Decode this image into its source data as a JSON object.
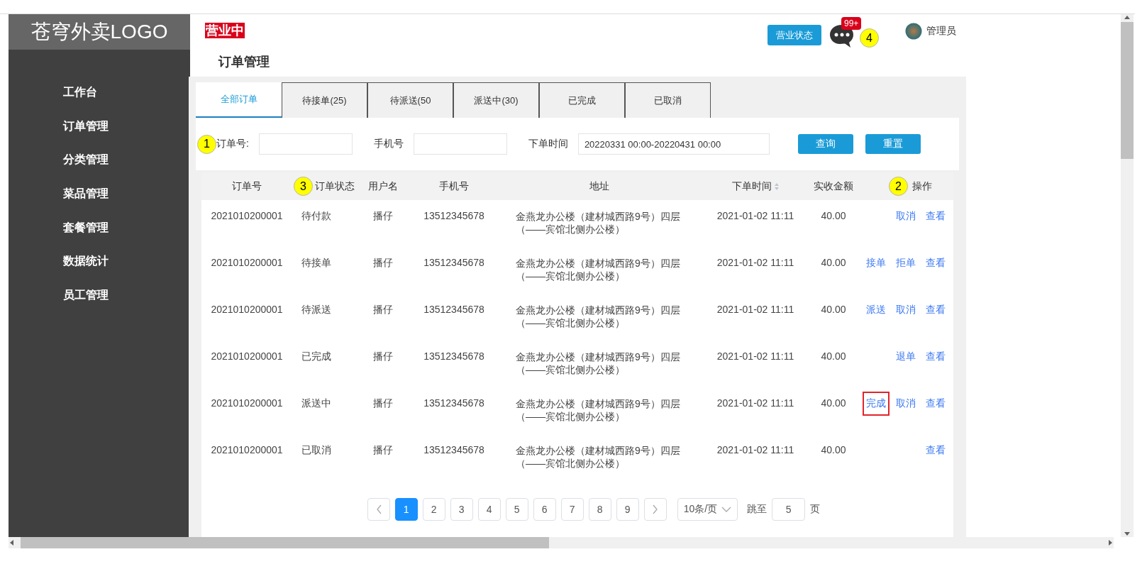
{
  "sidebar": {
    "logo": "苍穹外卖LOGO",
    "items": [
      {
        "label": "工作台"
      },
      {
        "label": "订单管理"
      },
      {
        "label": "分类管理"
      },
      {
        "label": "菜品管理"
      },
      {
        "label": "套餐管理"
      },
      {
        "label": "数据统计"
      },
      {
        "label": "员工管理"
      }
    ]
  },
  "header": {
    "status_badge": "营业中",
    "page_title": "订单管理",
    "status_button": "营业状态",
    "message_count": "99+",
    "message_marker": "4",
    "user": "管理员"
  },
  "tabs": [
    {
      "label": "全部订单",
      "selected": true
    },
    {
      "label": "待接单(25)",
      "selected": false
    },
    {
      "label": "待派送(50",
      "selected": false
    },
    {
      "label": "派送中(30)",
      "selected": false
    },
    {
      "label": "已完成",
      "selected": false
    },
    {
      "label": "已取消",
      "selected": false
    }
  ],
  "filter": {
    "marker": "1",
    "fields": [
      {
        "label": "订单号:"
      },
      {
        "label": "手机号"
      },
      {
        "label": "下单时间",
        "value": "20220331 00:00-20220431 00:00"
      }
    ],
    "buttons": [
      "查询",
      "重置"
    ]
  },
  "table": {
    "columns": [
      {
        "label": "订单号"
      },
      {
        "label": "订单状态",
        "marker": "3"
      },
      {
        "label": "用户名"
      },
      {
        "label": "手机号"
      },
      {
        "label": "地址"
      },
      {
        "label": "下单时间",
        "sortable": true
      },
      {
        "label": "实收金额"
      },
      {
        "label": "操作",
        "marker": "2"
      }
    ],
    "rows": [
      {
        "order_no": "2021010200001",
        "status": "待付款",
        "user": "播仔",
        "phone": "13512345678",
        "address": "金燕龙办公楼（建材城西路9号）四层（——宾馆北侧办公楼）",
        "time": "2021-01-02 11:11",
        "amount": "40.00",
        "actions": [
          {
            "label": "取消",
            "highlighted": false
          },
          {
            "label": "查看",
            "highlighted": false
          }
        ]
      },
      {
        "order_no": "2021010200001",
        "status": "待接单",
        "user": "播仔",
        "phone": "13512345678",
        "address": "金燕龙办公楼（建材城西路9号）四层（——宾馆北侧办公楼）",
        "time": "2021-01-02 11:11",
        "amount": "40.00",
        "actions": [
          {
            "label": "接单",
            "highlighted": false
          },
          {
            "label": "拒单",
            "highlighted": false
          },
          {
            "label": "查看",
            "highlighted": false
          }
        ]
      },
      {
        "order_no": "2021010200001",
        "status": "待派送",
        "user": "播仔",
        "phone": "13512345678",
        "address": "金燕龙办公楼（建材城西路9号）四层（——宾馆北侧办公楼）",
        "time": "2021-01-02 11:11",
        "amount": "40.00",
        "actions": [
          {
            "label": "派送",
            "highlighted": false
          },
          {
            "label": "取消",
            "highlighted": false
          },
          {
            "label": "查看",
            "highlighted": false
          }
        ]
      },
      {
        "order_no": "2021010200001",
        "status": "已完成",
        "user": "播仔",
        "phone": "13512345678",
        "address": "金燕龙办公楼（建材城西路9号）四层（——宾馆北侧办公楼）",
        "time": "2021-01-02 11:11",
        "amount": "40.00",
        "actions": [
          {
            "label": "退单",
            "highlighted": false
          },
          {
            "label": "查看",
            "highlighted": false
          }
        ]
      },
      {
        "order_no": "2021010200001",
        "status": "派送中",
        "user": "播仔",
        "phone": "13512345678",
        "address": "金燕龙办公楼（建材城西路9号）四层（——宾馆北侧办公楼）",
        "time": "2021-01-02 11:11",
        "amount": "40.00",
        "actions": [
          {
            "label": "完成",
            "highlighted": true
          },
          {
            "label": "取消",
            "highlighted": false
          },
          {
            "label": "查看",
            "highlighted": false
          }
        ]
      },
      {
        "order_no": "2021010200001",
        "status": "已取消",
        "user": "播仔",
        "phone": "13512345678",
        "address": "金燕龙办公楼（建材城西路9号）四层（——宾馆北侧办公楼）",
        "time": "2021-01-02 11:11",
        "amount": "40.00",
        "actions": [
          {
            "label": "查看",
            "highlighted": false
          }
        ]
      }
    ]
  },
  "pager": {
    "pages": [
      {
        "label": "1",
        "selected": true
      },
      {
        "label": "2",
        "selected": false
      },
      {
        "label": "3",
        "selected": false
      },
      {
        "label": "4",
        "selected": false
      },
      {
        "label": "5",
        "selected": false
      },
      {
        "label": "6",
        "selected": false
      },
      {
        "label": "7",
        "selected": false
      },
      {
        "label": "8",
        "selected": false
      },
      {
        "label": "9",
        "selected": false
      }
    ],
    "page_size": "10条/页",
    "jump_label": "跳至",
    "jump_value": "5",
    "page_suffix": "页"
  }
}
